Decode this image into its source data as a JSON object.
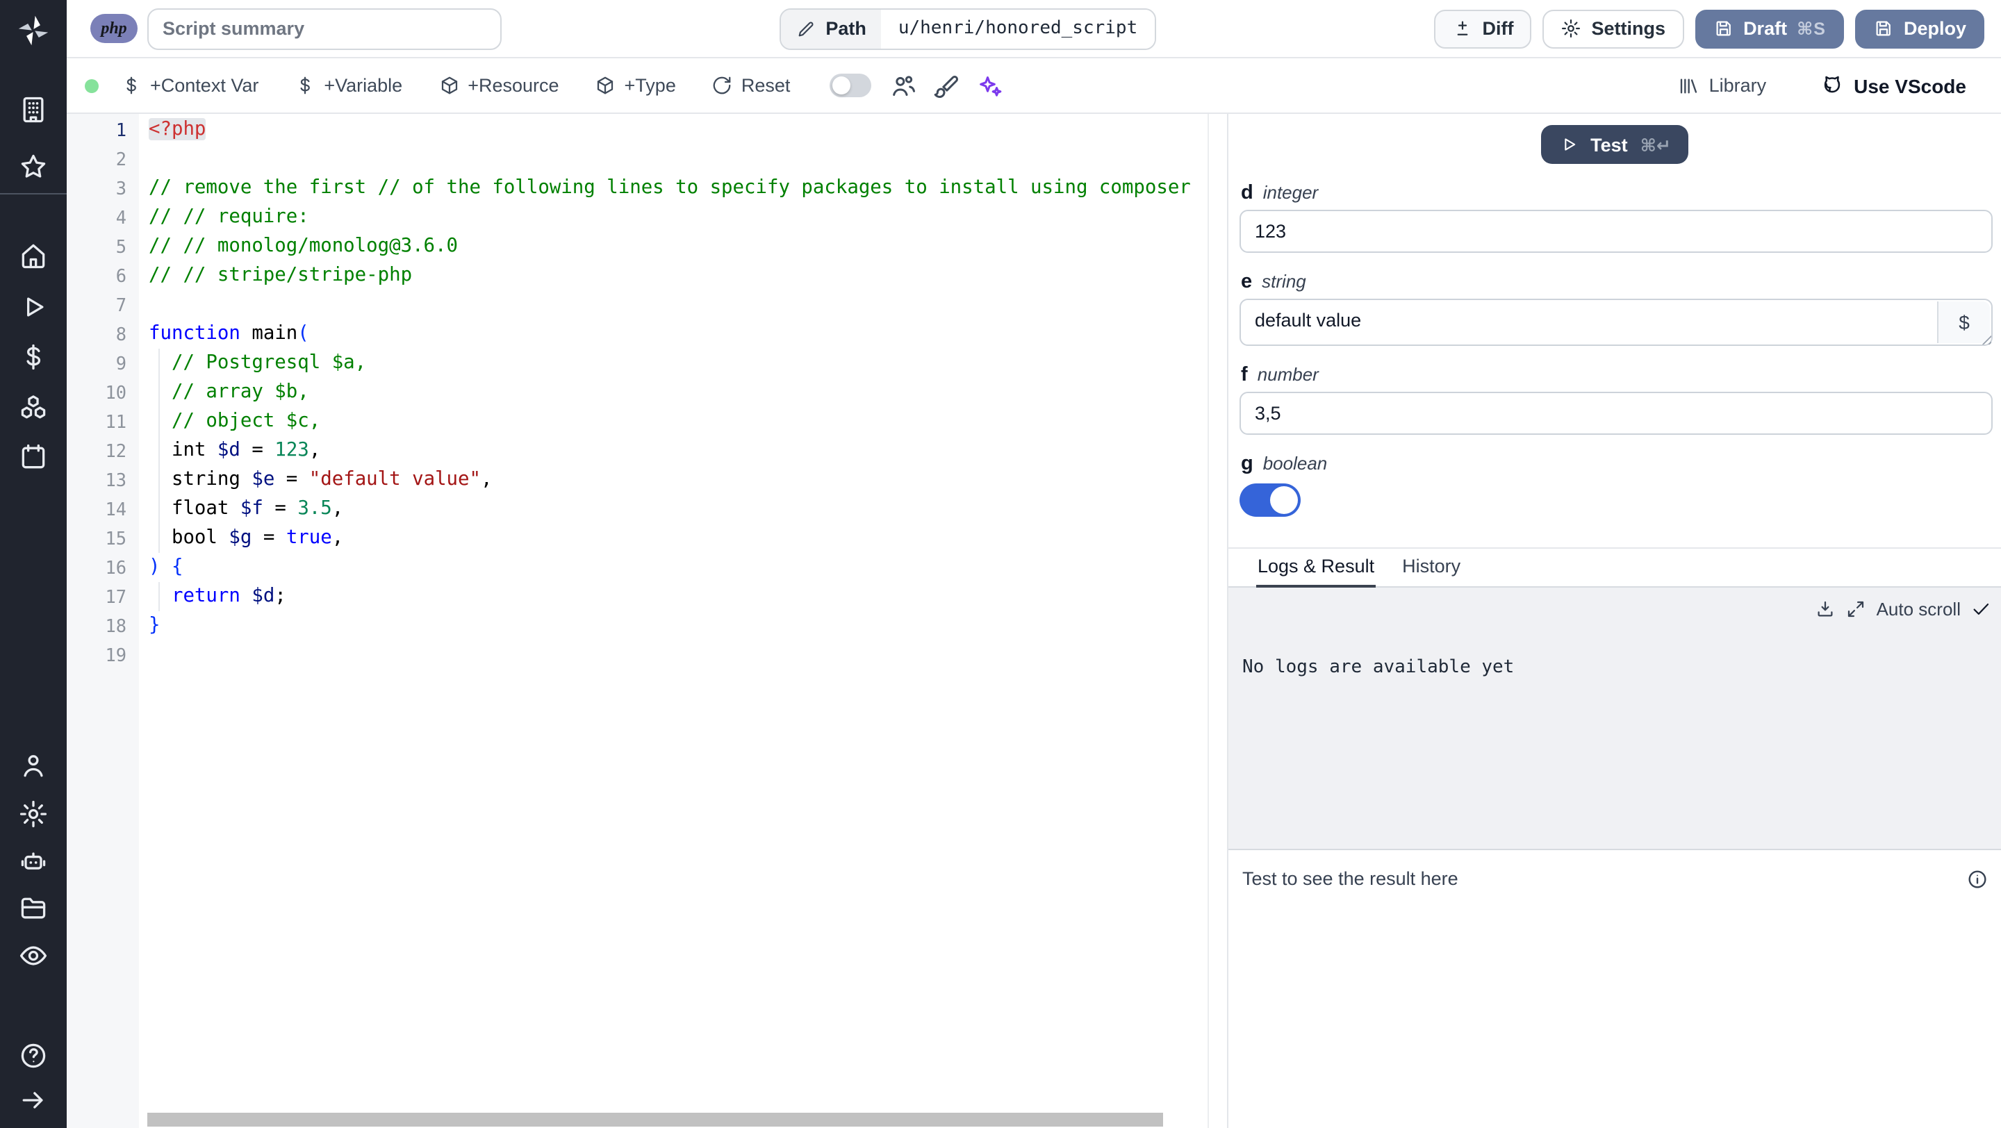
{
  "sidebar": {
    "logo_icon": "windmill-logo-icon",
    "top_icons": [
      "building-icon",
      "star-icon"
    ],
    "main_icons": [
      "home-icon",
      "play-icon",
      "dollar-icon",
      "cubes-icon",
      "calendar-icon"
    ],
    "account_icons": [
      "user-icon",
      "gear-icon",
      "robot-icon",
      "folder-icon",
      "eye-icon"
    ],
    "bottom_icons": [
      "help-icon",
      "arrow-right-icon"
    ]
  },
  "topbar": {
    "language_badge": "php",
    "summary_placeholder": "Script summary",
    "path": {
      "label": "Path",
      "value": "u/henri/honored_script",
      "icon": "pencil-icon"
    },
    "buttons": {
      "diff": {
        "label": "Diff",
        "icon": "diff-icon"
      },
      "settings": {
        "label": "Settings",
        "icon": "gear-icon"
      },
      "draft": {
        "label": "Draft",
        "shortcut": "⌘S",
        "icon": "save-icon"
      },
      "deploy": {
        "label": "Deploy",
        "icon": "save-icon"
      }
    }
  },
  "toolbar": {
    "actions": [
      {
        "label": "+Context Var",
        "icon": "dollar-icon"
      },
      {
        "label": "+Variable",
        "icon": "dollar-icon"
      },
      {
        "label": "+Resource",
        "icon": "package-icon"
      },
      {
        "label": "+Type",
        "icon": "package-icon"
      },
      {
        "label": "Reset",
        "icon": "reset-icon"
      }
    ],
    "multiplayer_toggle_on": false,
    "icon_buttons": [
      "users-icon",
      "format-brush-icon",
      "ai-sparkles-icon"
    ],
    "library_label": "Library",
    "library_icon": "library-icon",
    "vscode_label": "Use VScode",
    "vscode_icon": "vscode-icon"
  },
  "editor": {
    "language": "php",
    "lines": [
      {
        "n": 1,
        "active": true,
        "tokens": [
          {
            "text": "<?php",
            "type": "tag",
            "hl": true
          }
        ]
      },
      {
        "n": 2,
        "tokens": []
      },
      {
        "n": 3,
        "tokens": [
          {
            "text": "// remove the first // of the following lines to specify packages to install using composer",
            "type": "comment"
          }
        ]
      },
      {
        "n": 4,
        "tokens": [
          {
            "text": "// // require:",
            "type": "comment"
          }
        ]
      },
      {
        "n": 5,
        "tokens": [
          {
            "text": "// // monolog/monolog@3.6.0",
            "type": "comment"
          }
        ]
      },
      {
        "n": 6,
        "tokens": [
          {
            "text": "// // stripe/stripe-php",
            "type": "comment"
          }
        ]
      },
      {
        "n": 7,
        "tokens": []
      },
      {
        "n": 8,
        "tokens": [
          {
            "text": "function",
            "type": "keyword"
          },
          {
            "text": " main",
            "type": "plain"
          },
          {
            "text": "(",
            "type": "bracket"
          }
        ]
      },
      {
        "n": 9,
        "guide": true,
        "tokens": [
          {
            "text": "  // Postgresql $a,",
            "type": "comment"
          }
        ]
      },
      {
        "n": 10,
        "guide": true,
        "tokens": [
          {
            "text": "  // array $b,",
            "type": "comment"
          }
        ]
      },
      {
        "n": 11,
        "guide": true,
        "tokens": [
          {
            "text": "  // object $c,",
            "type": "comment"
          }
        ]
      },
      {
        "n": 12,
        "guide": true,
        "tokens": [
          {
            "text": "  int ",
            "type": "plain"
          },
          {
            "text": "$d",
            "type": "variable"
          },
          {
            "text": " = ",
            "type": "plain"
          },
          {
            "text": "123",
            "type": "number"
          },
          {
            "text": ",",
            "type": "plain"
          }
        ]
      },
      {
        "n": 13,
        "guide": true,
        "tokens": [
          {
            "text": "  string ",
            "type": "plain"
          },
          {
            "text": "$e",
            "type": "variable"
          },
          {
            "text": " = ",
            "type": "plain"
          },
          {
            "text": "\"default value\"",
            "type": "string"
          },
          {
            "text": ",",
            "type": "plain"
          }
        ]
      },
      {
        "n": 14,
        "guide": true,
        "tokens": [
          {
            "text": "  float ",
            "type": "plain"
          },
          {
            "text": "$f",
            "type": "variable"
          },
          {
            "text": " = ",
            "type": "plain"
          },
          {
            "text": "3.5",
            "type": "number"
          },
          {
            "text": ",",
            "type": "plain"
          }
        ]
      },
      {
        "n": 15,
        "guide": true,
        "tokens": [
          {
            "text": "  bool ",
            "type": "plain"
          },
          {
            "text": "$g",
            "type": "variable"
          },
          {
            "text": " = ",
            "type": "plain"
          },
          {
            "text": "true",
            "type": "keyword"
          },
          {
            "text": ",",
            "type": "plain"
          }
        ]
      },
      {
        "n": 16,
        "tokens": [
          {
            "text": ") {",
            "type": "bracket"
          }
        ]
      },
      {
        "n": 17,
        "guide": true,
        "tokens": [
          {
            "text": "  ",
            "type": "plain"
          },
          {
            "text": "return",
            "type": "keyword"
          },
          {
            "text": " ",
            "type": "plain"
          },
          {
            "text": "$d",
            "type": "variable"
          },
          {
            "text": ";",
            "type": "plain"
          }
        ]
      },
      {
        "n": 18,
        "tokens": [
          {
            "text": "}",
            "type": "bracket"
          }
        ]
      },
      {
        "n": 19,
        "tokens": []
      }
    ]
  },
  "runner": {
    "test_button": {
      "label": "Test",
      "shortcut": "⌘↵",
      "icon": "play-icon"
    },
    "fields": [
      {
        "name": "d",
        "type": "integer",
        "value": "123",
        "widget": "input"
      },
      {
        "name": "e",
        "type": "string",
        "value": "default value",
        "widget": "textarea",
        "suffix_button": "$"
      },
      {
        "name": "f",
        "type": "number",
        "value": "3,5",
        "widget": "input"
      },
      {
        "name": "g",
        "type": "boolean",
        "value": true,
        "widget": "toggle"
      }
    ],
    "tabs": [
      {
        "label": "Logs & Result",
        "active": true
      },
      {
        "label": "History",
        "active": false
      }
    ],
    "logs": {
      "icons": [
        "download-icon",
        "expand-icon"
      ],
      "auto_scroll_label": "Auto scroll",
      "auto_scroll_checked": true,
      "empty_text": "No logs are available yet"
    },
    "result": {
      "placeholder": "Test to see the result here",
      "info_icon": "info-icon"
    }
  },
  "colors": {
    "sidebar_bg": "#20242e",
    "primary_button": "#66799f",
    "dark_button": "#3a4760",
    "toggle_on": "#3564d9",
    "status_dot": "#86e29b",
    "ai_icon": "#7c3aed",
    "php_badge": "#7b80b8",
    "code": {
      "tag": "#cd3131",
      "comment": "#008000",
      "keyword": "#0000ff",
      "variable": "#001080",
      "number": "#098658",
      "string": "#a31515",
      "bracket": "#0431fa"
    }
  }
}
